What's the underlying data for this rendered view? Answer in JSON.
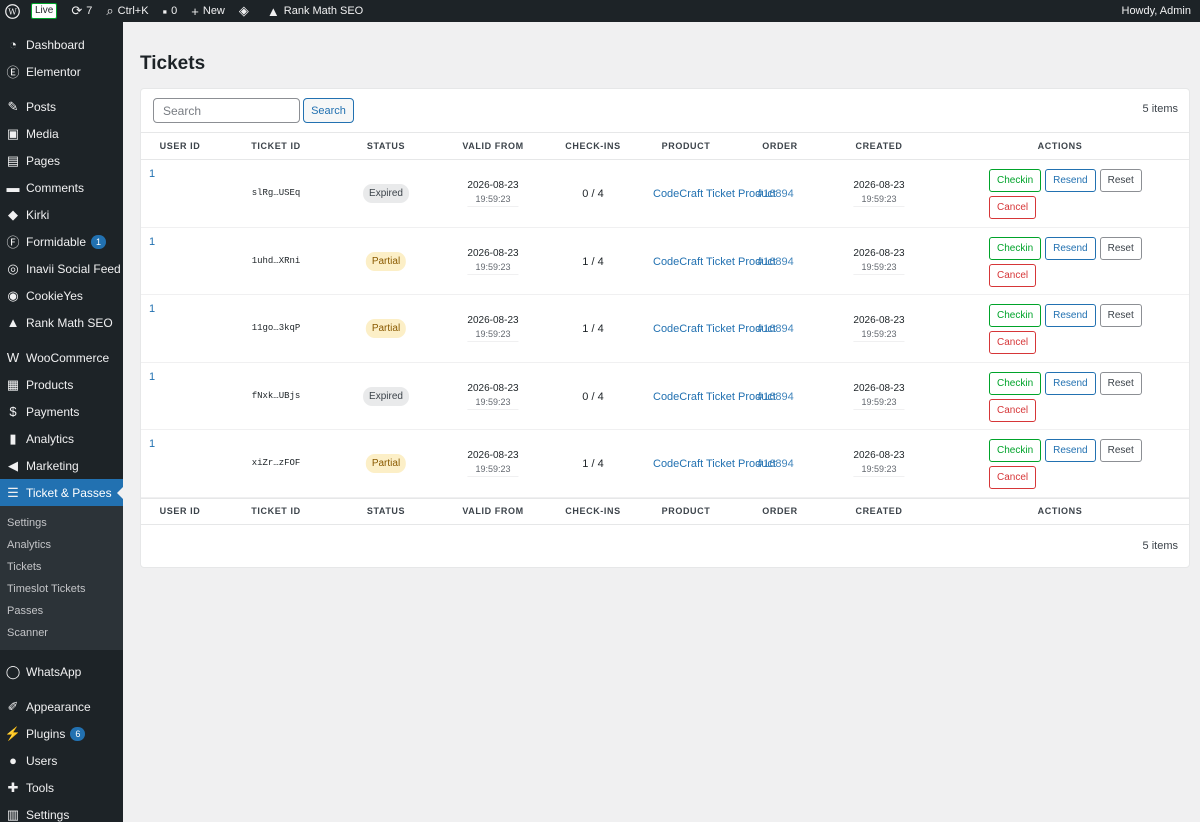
{
  "adminbar": {
    "live": "Live",
    "updates": "7",
    "shortcut": "Ctrl+K",
    "comments": "0",
    "new": "New",
    "rankmath": "Rank Math SEO",
    "howdy": "Howdy, Admin"
  },
  "sidebar": {
    "items": [
      {
        "label": "Dashboard",
        "icon": "dashboard-icon",
        "glyph": "◔"
      },
      {
        "label": "Elementor",
        "icon": "elementor-icon",
        "glyph": "Ⓔ"
      },
      {
        "label": "Posts",
        "icon": "pin-icon",
        "glyph": "✎"
      },
      {
        "label": "Media",
        "icon": "media-icon",
        "glyph": "▣"
      },
      {
        "label": "Pages",
        "icon": "pages-icon",
        "glyph": "▤"
      },
      {
        "label": "Comments",
        "icon": "comment-icon",
        "glyph": "▬"
      },
      {
        "label": "Kirki",
        "icon": "kirki-icon",
        "glyph": "◆"
      },
      {
        "label": "Formidable",
        "icon": "formidable-icon",
        "glyph": "Ⓕ",
        "badge": "1"
      },
      {
        "label": "Inavii Social Feed",
        "icon": "instagram-icon",
        "glyph": "◎"
      },
      {
        "label": "CookieYes",
        "icon": "cookie-icon",
        "glyph": "◉"
      },
      {
        "label": "Rank Math SEO",
        "icon": "rankmath-icon",
        "glyph": "▲"
      },
      {
        "label": "WooCommerce",
        "icon": "woocommerce-icon",
        "glyph": "W"
      },
      {
        "label": "Products",
        "icon": "products-icon",
        "glyph": "▦"
      },
      {
        "label": "Payments",
        "icon": "payments-icon",
        "glyph": "$"
      },
      {
        "label": "Analytics",
        "icon": "analytics-icon",
        "glyph": "▮"
      },
      {
        "label": "Marketing",
        "icon": "megaphone-icon",
        "glyph": "◀"
      },
      {
        "label": "Ticket & Passes",
        "icon": "ticket-icon",
        "glyph": "☰"
      },
      {
        "label": "WhatsApp",
        "icon": "whatsapp-icon",
        "glyph": "◯"
      },
      {
        "label": "Appearance",
        "icon": "appearance-icon",
        "glyph": "✐"
      },
      {
        "label": "Plugins",
        "icon": "plugins-icon",
        "glyph": "⚡",
        "badge": "6"
      },
      {
        "label": "Users",
        "icon": "users-icon",
        "glyph": "●"
      },
      {
        "label": "Tools",
        "icon": "tools-icon",
        "glyph": "✚"
      },
      {
        "label": "Settings",
        "icon": "settings-icon",
        "glyph": "▥"
      }
    ],
    "submenu": [
      "Settings",
      "Analytics",
      "Tickets",
      "Timeslot Tickets",
      "Passes",
      "Scanner"
    ]
  },
  "page": {
    "title": "Tickets",
    "search_placeholder": "Search",
    "search_button": "Search",
    "items_count": "5 items",
    "columns": [
      "User ID",
      "Ticket ID",
      "Status",
      "Valid From",
      "Check-ins",
      "Product",
      "Order",
      "Created",
      "Actions"
    ],
    "rows": [
      {
        "user_id": "1",
        "ticket_id": "slRg…USEq",
        "status": "Expired",
        "status_kind": "expired",
        "valid_date": "2026-08-23",
        "valid_time": "19:59:23",
        "checkins": "0 / 4",
        "product": "CodeCraft Ticket Product",
        "order": "#16894",
        "created_date": "2026-08-23",
        "created_time": "19:59:23"
      },
      {
        "user_id": "1",
        "ticket_id": "1uhd…XRni",
        "status": "Partial",
        "status_kind": "partial",
        "valid_date": "2026-08-23",
        "valid_time": "19:59:23",
        "checkins": "1 / 4",
        "product": "CodeCraft Ticket Product",
        "order": "#16894",
        "created_date": "2026-08-23",
        "created_time": "19:59:23"
      },
      {
        "user_id": "1",
        "ticket_id": "11go…3kqP",
        "status": "Partial",
        "status_kind": "partial",
        "valid_date": "2026-08-23",
        "valid_time": "19:59:23",
        "checkins": "1 / 4",
        "product": "CodeCraft Ticket Product",
        "order": "#16894",
        "created_date": "2026-08-23",
        "created_time": "19:59:23"
      },
      {
        "user_id": "1",
        "ticket_id": "fNxk…UBjs",
        "status": "Expired",
        "status_kind": "expired",
        "valid_date": "2026-08-23",
        "valid_time": "19:59:23",
        "checkins": "0 / 4",
        "product": "CodeCraft Ticket Product",
        "order": "#16894",
        "created_date": "2026-08-23",
        "created_time": "19:59:23"
      },
      {
        "user_id": "1",
        "ticket_id": "xiZr…zFOF",
        "status": "Partial",
        "status_kind": "partial",
        "valid_date": "2026-08-23",
        "valid_time": "19:59:23",
        "checkins": "1 / 4",
        "product": "CodeCraft Ticket Product",
        "order": "#16894",
        "created_date": "2026-08-23",
        "created_time": "19:59:23"
      }
    ],
    "actions": {
      "checkin": "Checkin",
      "resend": "Resend",
      "reset": "Reset",
      "cancel": "Cancel"
    }
  }
}
